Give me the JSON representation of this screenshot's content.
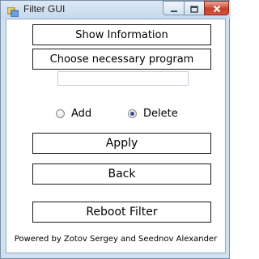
{
  "window": {
    "title": "Filter GUI",
    "icons": {
      "app": "app-window-icon",
      "minimize": "minimize-icon",
      "maximize": "maximize-icon",
      "close": "close-icon"
    }
  },
  "buttons": {
    "show_information": "Show Information",
    "choose_program": "Choose necessary program",
    "apply": "Apply",
    "back": "Back",
    "reboot_filter": "Reboot Filter"
  },
  "program_input": {
    "value": "",
    "placeholder": ""
  },
  "mode": {
    "options": [
      "Add",
      "Delete"
    ],
    "selected": "Delete"
  },
  "footer": {
    "text": "Powered by Zotov Sergey and Seednov Alexander"
  }
}
